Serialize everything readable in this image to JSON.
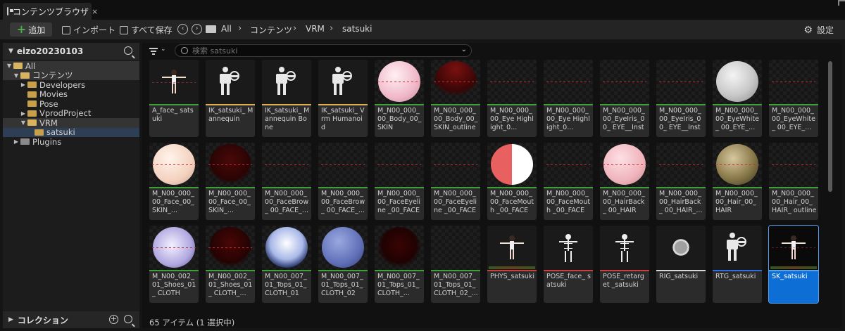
{
  "tab": {
    "title": "コンテンツブラウザ",
    "close": "×"
  },
  "toolbar": {
    "add_label": "追加",
    "import_label": "インポート",
    "save_all_label": "すべて保存",
    "breadcrumbs": [
      "All",
      "コンテンツ",
      "VRM",
      "satsuki"
    ],
    "settings_label": "設定"
  },
  "sidebar": {
    "project": "eizo20230103",
    "tree": [
      {
        "label": "All"
      },
      {
        "label": "コンテンツ"
      },
      {
        "label": "Developers"
      },
      {
        "label": "Movies"
      },
      {
        "label": "Pose"
      },
      {
        "label": "VprodProject"
      },
      {
        "label": "VRM"
      },
      {
        "label": "satsuki"
      },
      {
        "label": "Plugins"
      }
    ],
    "collections_label": "コレクション"
  },
  "search": {
    "placeholder": "検索 satsuki"
  },
  "colors": {
    "green": "#3f9f3a",
    "yellow": "#e0b050",
    "red": "#c84040",
    "white": "#d8d8d8",
    "blue": "#2f6fe0",
    "selected": "#0d6fd6"
  },
  "assets": [
    {
      "name": "A_face_ satsuki"
    },
    {
      "name": "IK_satsuki_ Mannequin"
    },
    {
      "name": "IK_satsuki_ Mannequin Bone"
    },
    {
      "name": "IK_satsuki_ Vrm Humanoid"
    },
    {
      "name": "M_N00_000_ 00_Body_00_ SKIN"
    },
    {
      "name": "M_N00_000_ 00_Body_00_ SKIN_outline"
    },
    {
      "name": "M_N00_000_ 00_Eye Highlight_0..."
    },
    {
      "name": "M_N00_000_ 00_Eye Highlight_0..."
    },
    {
      "name": "M_N00_000_ 00_EyeIris_00_ EYE__Insta..."
    },
    {
      "name": "M_N00_000_ 00_EyeIris_00_ EYE__Insta..."
    },
    {
      "name": "M_N00_000_ 00_EyeWhite_ 00_EYE_..."
    },
    {
      "name": "M_N00_000_ 00_EyeWhite_ 00_EYE_..."
    },
    {
      "name": "M_N00_000_ 00_Face_00_ SKIN_..."
    },
    {
      "name": "M_N00_000_ 00_Face_00_ SKIN_..."
    },
    {
      "name": "M_N00_000_ 00_FaceBrow_ 00_FACE_..."
    },
    {
      "name": "M_N00_000_ 00_FaceBrow_ 00_FACE_..."
    },
    {
      "name": "M_N00_000_ 00_FaceEyeline _00_FACE_..."
    },
    {
      "name": "M_N00_000_ 00_FaceEyeline _00_FACE_..."
    },
    {
      "name": "M_N00_000_ 00_FaceMouth _00_FACE_..."
    },
    {
      "name": "M_N00_000_ 00_FaceMouth _00_FACE_..."
    },
    {
      "name": "M_N00_000_ 00_HairBack_ 00_HAIR"
    },
    {
      "name": "M_N00_000_ 00_HairBack_ 00_HAIR_..."
    },
    {
      "name": "M_N00_000_ 00_Hair_00_HAIR"
    },
    {
      "name": "M_N00_000_ 00_Hair_00_HAIR_ outline"
    },
    {
      "name": "M_N00_002_ 01_Shoes_01_ CLOTH"
    },
    {
      "name": "M_N00_002_ 01_Shoes_01_ CLOTH_..."
    },
    {
      "name": "M_N00_007_ 01_Tops_01_ CLOTH_01"
    },
    {
      "name": "M_N00_007_ 01_Tops_01_ CLOTH_02"
    },
    {
      "name": "M_N00_007_ 01_Tops_01_ CLOTH_..."
    },
    {
      "name": "M_N00_007_ 01_Tops_01_ CLOTH_02_..."
    },
    {
      "name": "PHYS_satsuki"
    },
    {
      "name": "POSE_face_ satsuki"
    },
    {
      "name": "POSE_retarget _satsuki"
    },
    {
      "name": "RIG_satsuki"
    },
    {
      "name": "RTG_satsuki"
    },
    {
      "name": "SK_satsuki"
    }
  ],
  "status": {
    "text": "65 アイテム (1 選択中)"
  }
}
